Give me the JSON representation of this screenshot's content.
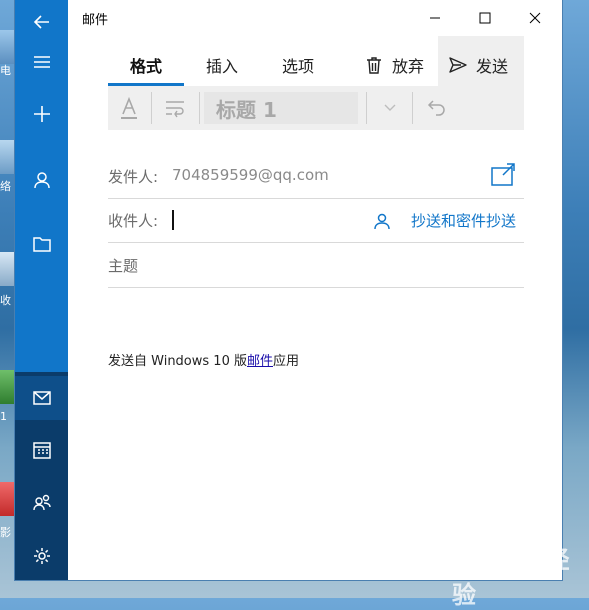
{
  "desktop": {
    "labels": [
      "电",
      "络",
      "收",
      "1",
      "影"
    ]
  },
  "window": {
    "title": "邮件",
    "controls": {
      "minimize": "minimize-icon",
      "maximize": "maximize-icon",
      "close": "close-icon"
    }
  },
  "sidebar": {
    "icons": [
      "back-arrow-icon",
      "hamburger-menu-icon",
      "plus-icon",
      "person-icon",
      "folder-icon",
      "mail-icon",
      "calendar-icon",
      "people-icon",
      "settings-gear-icon"
    ]
  },
  "ribbon": {
    "tabs": [
      {
        "label": "格式",
        "active": true
      },
      {
        "label": "插入",
        "active": false
      },
      {
        "label": "选项",
        "active": false
      }
    ],
    "discard_label": "放弃",
    "send_label": "发送",
    "heading_value": "标题 1"
  },
  "compose": {
    "from_label": "发件人:",
    "from_value": "704859599@qq.com",
    "to_label": "收件人:",
    "cc_bcc_label": "抄送和密件抄送",
    "subject_placeholder": "主题"
  },
  "signature": {
    "prefix": "发送自 Windows 10 版",
    "link": "邮件",
    "suffix": "应用"
  },
  "watermark": {
    "text": "Baidu 经验"
  },
  "colors": {
    "accent": "#1176c9",
    "sidebar_dark": "#0b3c6a"
  }
}
